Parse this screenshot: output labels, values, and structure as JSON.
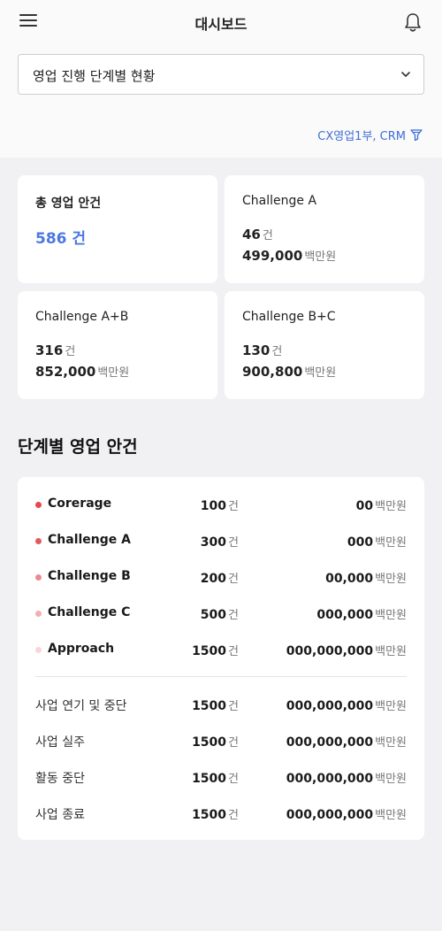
{
  "header": {
    "title": "대시보드",
    "menu_icon": "hamburger-menu-icon",
    "notification_icon": "bell-icon"
  },
  "select": {
    "value": "영업 진행 단계별 현황"
  },
  "filter": {
    "label": "CX영업1부, CRM",
    "icon": "filter-icon"
  },
  "units": {
    "count": "건",
    "amount": "백만원"
  },
  "summary": {
    "total": {
      "title": "총 영업 안건",
      "count": "586",
      "unit": "건"
    },
    "cards": [
      {
        "title": "Challenge A",
        "count": "46",
        "amount": "499,000"
      },
      {
        "title": "Challenge A+B",
        "count": "316",
        "amount": "852,000"
      },
      {
        "title": "Challenge B+C",
        "count": "130",
        "amount": "900,800"
      }
    ]
  },
  "stages": {
    "title": "단계별 영업 안건",
    "active": [
      {
        "label": "Corerage",
        "count": "100",
        "amount": "00",
        "color": "#e5484d"
      },
      {
        "label": "Challenge A",
        "count": "300",
        "amount": "000",
        "color": "#e5585d"
      },
      {
        "label": "Challenge B",
        "count": "200",
        "amount": "00,000",
        "color": "#ee8a8e"
      },
      {
        "label": "Challenge C",
        "count": "500",
        "amount": "000,000",
        "color": "#f4aeb1"
      },
      {
        "label": "Approach",
        "count": "1500",
        "amount": "000,000,000",
        "color": "#f9d6d8"
      }
    ],
    "closed": [
      {
        "label": "사업 연기 및 중단",
        "count": "1500",
        "amount": "000,000,000"
      },
      {
        "label": "사업 실주",
        "count": "1500",
        "amount": "000,000,000"
      },
      {
        "label": "활동 중단",
        "count": "1500",
        "amount": "000,000,000"
      },
      {
        "label": "사업 종료",
        "count": "1500",
        "amount": "000,000,000"
      }
    ]
  }
}
